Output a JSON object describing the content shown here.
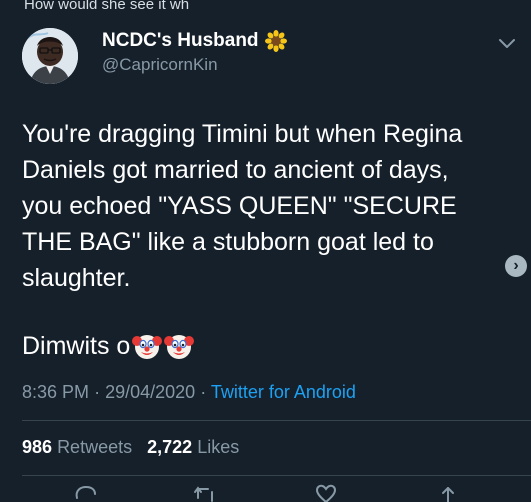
{
  "reply_context": "How would she see it wh",
  "user": {
    "display_name": "NCDC's Husband",
    "handle": "@CapricornKin"
  },
  "tweet": {
    "lines": [
      "You're dragging Timini but when Regina",
      "Daniels got married to ancient of days,",
      "you echoed \"YASS QUEEN\" \"SECURE",
      "THE BAG\" like a stubborn goat led to",
      "slaughter."
    ],
    "closing": "Dimwits o"
  },
  "meta": {
    "time": "8:36 PM",
    "separator": "·",
    "date": "29/04/2020",
    "source": "Twitter for Android"
  },
  "stats": {
    "retweets_count": "986",
    "retweets_label": "Retweets",
    "likes_count": "2,722",
    "likes_label": "Likes"
  },
  "colors": {
    "background": "#15202b",
    "secondary_text": "#8899a6",
    "link": "#1da1f2",
    "divider": "#38444d"
  },
  "icons": {
    "badge": "sunflower-icon",
    "emoji": "clown-face-icon",
    "more": "chevron-down-icon",
    "scroll": "chevron-right-icon",
    "actions": [
      "reply-icon",
      "retweet-icon",
      "like-icon",
      "share-icon"
    ]
  }
}
